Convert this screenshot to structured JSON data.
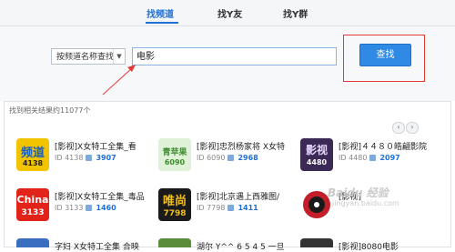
{
  "tabs": [
    {
      "label": "找频道",
      "active": true
    },
    {
      "label": "找Y友",
      "active": false
    },
    {
      "label": "找Y群",
      "active": false
    }
  ],
  "search": {
    "mode": "按频道名称查找",
    "query": "电影",
    "button": "查找"
  },
  "results": {
    "summary": "找到相关结果约11077个",
    "pager_prev": "‹",
    "pager_next": "›",
    "items": [
      {
        "name": "[影视]X女特工全集_看",
        "id_label": "ID",
        "id": "4138",
        "count": "3907",
        "thumb_text": "频道",
        "thumb_sub": "4138",
        "thumb_color": "#f2c400"
      },
      {
        "name": "[影视]忠烈杨家将 X女特",
        "id_label": "ID",
        "id": "6090",
        "count": "2968",
        "thumb_text": "青苹果",
        "thumb_sub": "6090",
        "thumb_color": "#dff1d6"
      },
      {
        "name": "[影视]４４８０皓翩影院",
        "id_label": "ID",
        "id": "4480",
        "count": "2097",
        "thumb_text": "影视",
        "thumb_sub": "4480",
        "thumb_color": "#3b2a55"
      },
      {
        "name": "[影视]X女特工全集_毒品",
        "id_label": "ID",
        "id": "3133",
        "count": "1460",
        "thumb_text": "China",
        "thumb_sub": "3133",
        "thumb_color": "#e2231a"
      },
      {
        "name": "[影视]北京遇上西雅图/",
        "id_label": "ID",
        "id": "7798",
        "count": "1411",
        "thumb_text": "唯尚",
        "thumb_sub": "7798",
        "thumb_color": "#1a1a1a"
      },
      {
        "name": "[影视]",
        "id_label": "ID",
        "id": "",
        "count": "",
        "thumb_text": "",
        "thumb_sub": "",
        "thumb_color": "#c21f2a"
      }
    ],
    "partial_row": [
      "字妇  X女特工全集   合映",
      "湖尔  Y^^  6 5 4 5  一旦",
      "[影视]8080电影"
    ]
  },
  "watermark": {
    "brand": "Baidu 经验",
    "url": "jingyan.baidu.com"
  },
  "colors": {
    "accent": "#1f6fd6",
    "button": "#2f8ae6",
    "highlight": "#e53935"
  }
}
